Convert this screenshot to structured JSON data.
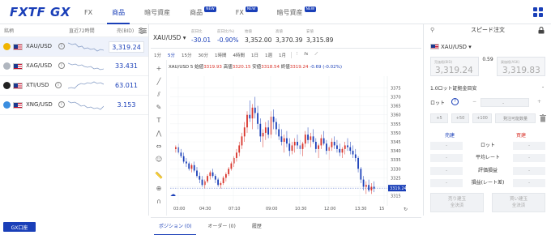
{
  "header": {
    "logo": "FXTF GX",
    "tabs": [
      {
        "label": "FX",
        "badge": ""
      },
      {
        "label": "商品",
        "badge": ""
      },
      {
        "label": "暗号資産",
        "badge": ""
      },
      {
        "label": "商品",
        "badge": "NEW"
      },
      {
        "label": "FX",
        "badge": "NEW"
      },
      {
        "label": "暗号資産",
        "badge": "NEW"
      }
    ],
    "active_tab": 1
  },
  "watchlist": {
    "col_symbol": "銘柄",
    "col_chart": "直近72時間",
    "col_price": "売(BID)",
    "rows": [
      {
        "symbol": "XAU/USD",
        "price": "3,319.24",
        "icon_color": "#f0b400",
        "selected": true
      },
      {
        "symbol": "XAG/USD",
        "price": "33.431",
        "icon_color": "#b0b6bf",
        "selected": false
      },
      {
        "symbol": "XTI/USD",
        "price": "63.011",
        "icon_color": "#222222",
        "selected": false
      },
      {
        "symbol": "XNG/USD",
        "price": "3.153",
        "icon_color": "#3b8ee0",
        "selected": false
      }
    ],
    "fx_account_button": "GX口座"
  },
  "chart_panel": {
    "symbol": "XAU/USD",
    "stats": [
      {
        "label": "前日比",
        "value": "-30.01",
        "blue": true
      },
      {
        "label": "前日比(%)",
        "value": "-0.90%",
        "blue": true
      },
      {
        "label": "始値",
        "value": "3,352.00",
        "blue": false
      },
      {
        "label": "高値",
        "value": "3,370.39",
        "blue": false
      },
      {
        "label": "安値",
        "value": "3,315.89",
        "blue": false
      }
    ],
    "timeframes": [
      "1分",
      "5分",
      "15分",
      "30分",
      "1時間",
      "4時間",
      "1日",
      "1週",
      "1月"
    ],
    "active_timeframe": 1,
    "chart_header": {
      "symbol": "XAU/USD",
      "interval": "5",
      "open_label": "始値",
      "open": "3319.93",
      "high_label": "高値",
      "high": "3320.15",
      "low_label": "安値",
      "low": "3318.54",
      "close_label": "終値",
      "close": "3319.24",
      "change": "-0.69 (-0.02%)"
    },
    "current_price_tag": "3319.24"
  },
  "chart_data": {
    "type": "candlestick",
    "x_ticks": [
      "03:00",
      "04:30",
      "07:10",
      "09:00",
      "10:30",
      "12:00",
      "13:30",
      "15"
    ],
    "y_ticks": [
      3375,
      3370,
      3365,
      3360,
      3355,
      3350,
      3345,
      3340,
      3335,
      3330,
      3325,
      3320,
      3315
    ],
    "ylim": [
      3313,
      3377
    ],
    "current_price": 3319.24,
    "candles": [
      [
        3341,
        3343,
        3339,
        3342
      ],
      [
        3342,
        3344,
        3338,
        3339
      ],
      [
        3339,
        3341,
        3336,
        3337
      ],
      [
        3337,
        3339,
        3333,
        3334
      ],
      [
        3334,
        3336,
        3331,
        3333
      ],
      [
        3333,
        3334,
        3329,
        3330
      ],
      [
        3330,
        3333,
        3328,
        3332
      ],
      [
        3332,
        3334,
        3328,
        3329
      ],
      [
        3329,
        3331,
        3325,
        3326
      ],
      [
        3326,
        3328,
        3322,
        3324
      ],
      [
        3324,
        3326,
        3320,
        3321
      ],
      [
        3321,
        3324,
        3319,
        3323
      ],
      [
        3323,
        3327,
        3322,
        3326
      ],
      [
        3326,
        3329,
        3324,
        3328
      ],
      [
        3328,
        3330,
        3325,
        3326
      ],
      [
        3326,
        3327,
        3322,
        3324
      ],
      [
        3324,
        3325,
        3320,
        3321
      ],
      [
        3321,
        3323,
        3319,
        3322
      ],
      [
        3322,
        3326,
        3321,
        3325
      ],
      [
        3325,
        3328,
        3323,
        3327
      ],
      [
        3327,
        3331,
        3326,
        3330
      ],
      [
        3330,
        3334,
        3329,
        3333
      ],
      [
        3333,
        3337,
        3331,
        3336
      ],
      [
        3336,
        3341,
        3334,
        3339
      ],
      [
        3339,
        3345,
        3337,
        3343
      ],
      [
        3343,
        3350,
        3341,
        3348
      ],
      [
        3348,
        3356,
        3345,
        3353
      ],
      [
        3353,
        3362,
        3350,
        3360
      ],
      [
        3360,
        3368,
        3356,
        3358
      ],
      [
        3358,
        3366,
        3352,
        3364
      ],
      [
        3364,
        3370,
        3358,
        3361
      ],
      [
        3361,
        3365,
        3352,
        3355
      ],
      [
        3355,
        3358,
        3345,
        3348
      ],
      [
        3348,
        3352,
        3342,
        3350
      ],
      [
        3350,
        3356,
        3346,
        3353
      ],
      [
        3353,
        3357,
        3347,
        3349
      ],
      [
        3349,
        3362,
        3347,
        3359
      ],
      [
        3359,
        3363,
        3352,
        3356
      ],
      [
        3356,
        3358,
        3349,
        3352
      ],
      [
        3352,
        3355,
        3346,
        3348
      ],
      [
        3348,
        3352,
        3343,
        3345
      ],
      [
        3345,
        3349,
        3339,
        3347
      ],
      [
        3347,
        3351,
        3342,
        3344
      ],
      [
        3344,
        3347,
        3337,
        3340
      ],
      [
        3340,
        3345,
        3338,
        3343
      ],
      [
        3343,
        3347,
        3339,
        3345
      ],
      [
        3345,
        3349,
        3341,
        3343
      ],
      [
        3343,
        3346,
        3338,
        3341
      ],
      [
        3341,
        3345,
        3337,
        3344
      ],
      [
        3344,
        3351,
        3342,
        3349
      ],
      [
        3349,
        3353,
        3344,
        3346
      ],
      [
        3346,
        3350,
        3342,
        3348
      ],
      [
        3348,
        3352,
        3344,
        3345
      ],
      [
        3345,
        3347,
        3339,
        3341
      ],
      [
        3341,
        3344,
        3336,
        3343
      ],
      [
        3343,
        3349,
        3341,
        3347
      ],
      [
        3347,
        3351,
        3343,
        3344
      ],
      [
        3344,
        3346,
        3338,
        3340
      ],
      [
        3340,
        3343,
        3335,
        3342
      ],
      [
        3342,
        3347,
        3340,
        3345
      ],
      [
        3345,
        3348,
        3341,
        3343
      ],
      [
        3343,
        3346,
        3339,
        3341
      ],
      [
        3341,
        3344,
        3337,
        3339
      ],
      [
        3339,
        3342,
        3336,
        3341
      ],
      [
        3341,
        3345,
        3338,
        3343
      ],
      [
        3343,
        3347,
        3340,
        3342
      ],
      [
        3342,
        3345,
        3338,
        3340
      ],
      [
        3340,
        3343,
        3336,
        3338
      ],
      [
        3338,
        3341,
        3334,
        3336
      ],
      [
        3336,
        3337,
        3328,
        3330
      ],
      [
        3330,
        3331,
        3322,
        3324
      ],
      [
        3324,
        3326,
        3318,
        3320
      ],
      [
        3320,
        3323,
        3316,
        3321
      ],
      [
        3321,
        3324,
        3317,
        3318
      ],
      [
        3318,
        3322,
        3316,
        3320
      ],
      [
        3320,
        3323,
        3317,
        3319
      ]
    ]
  },
  "bottom_tabs": [
    "ポジション (0)",
    "オーダー (0)",
    "履歴"
  ],
  "speed_order": {
    "title": "スピード注文",
    "symbol": "XAU/USD",
    "bid_label": "売価格(BID)",
    "bid": "3,319.24",
    "spread": "0.59",
    "ask_label": "買価格(ASK)",
    "ask": "3,319.83",
    "lot_guide": "1.0ロット証拠金目安",
    "lot_guide_value": "-",
    "lot_label": "ロット",
    "lot_value": "-",
    "quick_lots": [
      "+5",
      "+50",
      "+100"
    ],
    "max_button": "発注可能数量",
    "sell_header": "売建",
    "buy_header": "買建",
    "rows": [
      "ロット",
      "平均レート",
      "評価損益",
      "損益(レート差)"
    ],
    "sell_value": "-",
    "buy_value": "-",
    "sell_button": [
      "売り建玉",
      "全決済"
    ],
    "buy_button": [
      "買い建玉",
      "全決済"
    ]
  },
  "colors": {
    "brand": "#1a3fb8",
    "up": "#d9342b",
    "down": "#1a3fb8",
    "sell": "#1a3fb8",
    "buy": "#d9342b"
  }
}
